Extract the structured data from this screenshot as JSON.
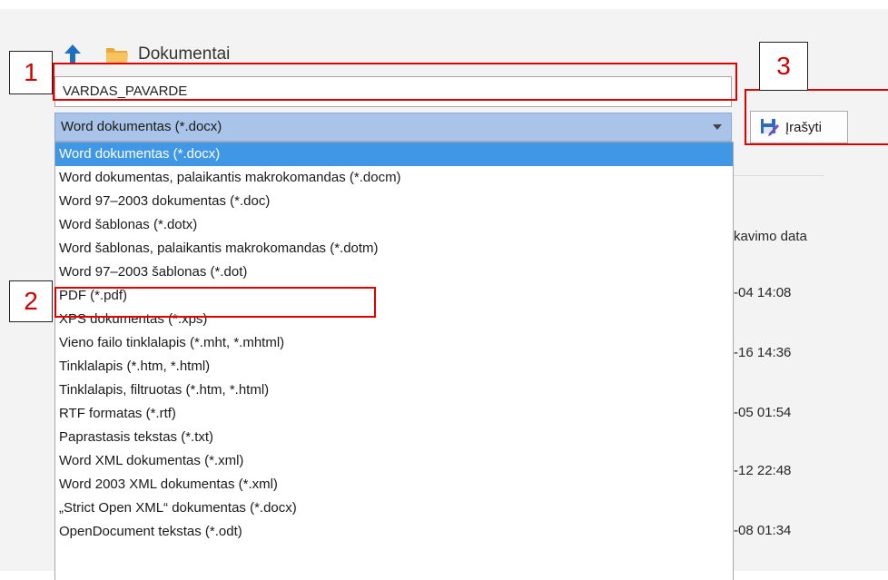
{
  "window": {
    "folder_name": "Dokumentai"
  },
  "file": {
    "name_value": "VARDAS_PAVARDE",
    "selected_type": "Word dokumentas (*.docx)"
  },
  "save_button": {
    "label": "Įrašyti"
  },
  "file_types": [
    "Word dokumentas (*.docx)",
    "Word dokumentas, palaikantis makrokomandas (*.docm)",
    "Word 97–2003 dokumentas (*.doc)",
    "Word šablonas (*.dotx)",
    "Word šablonas, palaikantis makrokomandas (*.dotm)",
    "Word 97–2003 šablonas (*.dot)",
    "PDF (*.pdf)",
    "XPS dokumentas (*.xps)",
    "Vieno failo tinklalapis (*.mht, *.mhtml)",
    "Tinklalapis (*.htm, *.html)",
    "Tinklalapis, filtruotas (*.htm, *.html)",
    "RTF formatas (*.rtf)",
    "Paprastasis tekstas (*.txt)",
    "Word XML dokumentas (*.xml)",
    "Word 2003 XML dokumentas (*.xml)",
    "„Strict Open XML“ dokumentas (*.docx)",
    "OpenDocument tekstas (*.odt)"
  ],
  "file_list": {
    "date_header": "kavimo data",
    "dates": [
      "-04 14:08",
      "-16 14:36",
      "-05 01:54",
      "-12 22:48",
      "-08 01:34"
    ]
  },
  "annotations": {
    "step1": "1",
    "step2": "2",
    "step3": "3"
  },
  "colors": {
    "highlight": "#3f97e6",
    "select_bg": "#a9c4e8",
    "annotation_red": "#e00000",
    "up_arrow": "#1e6fc1",
    "folder": "#f3b64b"
  }
}
